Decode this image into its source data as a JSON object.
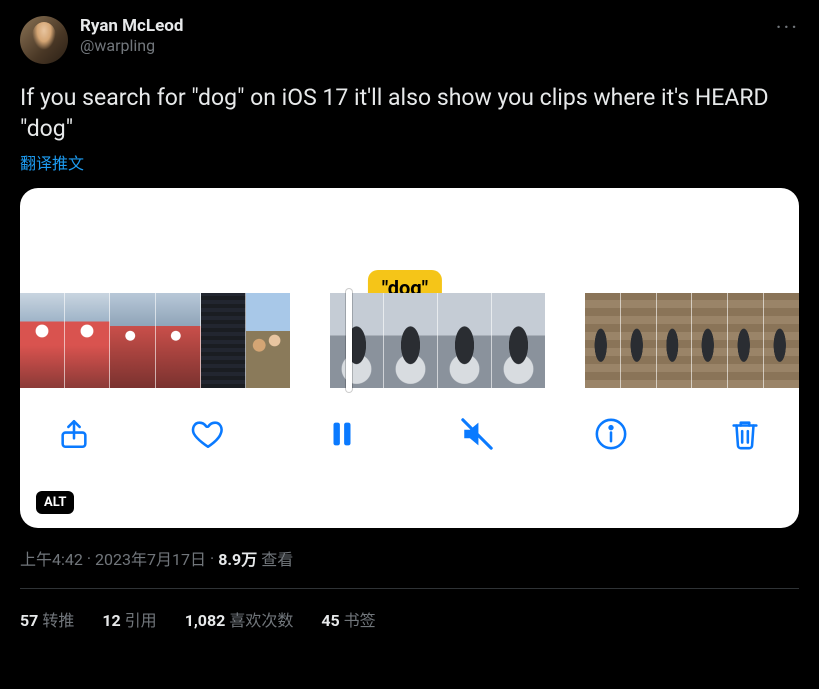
{
  "user": {
    "display_name": "Ryan McLeod",
    "handle": "@warpling"
  },
  "more_glyph": "···",
  "body": "If you search for \"dog\" on iOS 17 it'll also show you clips where it's HEARD \"dog\"",
  "translate_label": "翻译推文",
  "media": {
    "tooltip": "\"dog\"",
    "alt_badge": "ALT"
  },
  "meta": {
    "time": "上午4:42",
    "dot1": "·",
    "date": "2023年7月17日",
    "dot2": "·",
    "views_value": "8.9万",
    "views_label": "查看"
  },
  "stats": {
    "retweets": {
      "count": "57",
      "label": "转推"
    },
    "quotes": {
      "count": "12",
      "label": "引用"
    },
    "likes": {
      "count": "1,082",
      "label": "喜欢次数"
    },
    "bookmarks": {
      "count": "45",
      "label": "书签"
    }
  }
}
